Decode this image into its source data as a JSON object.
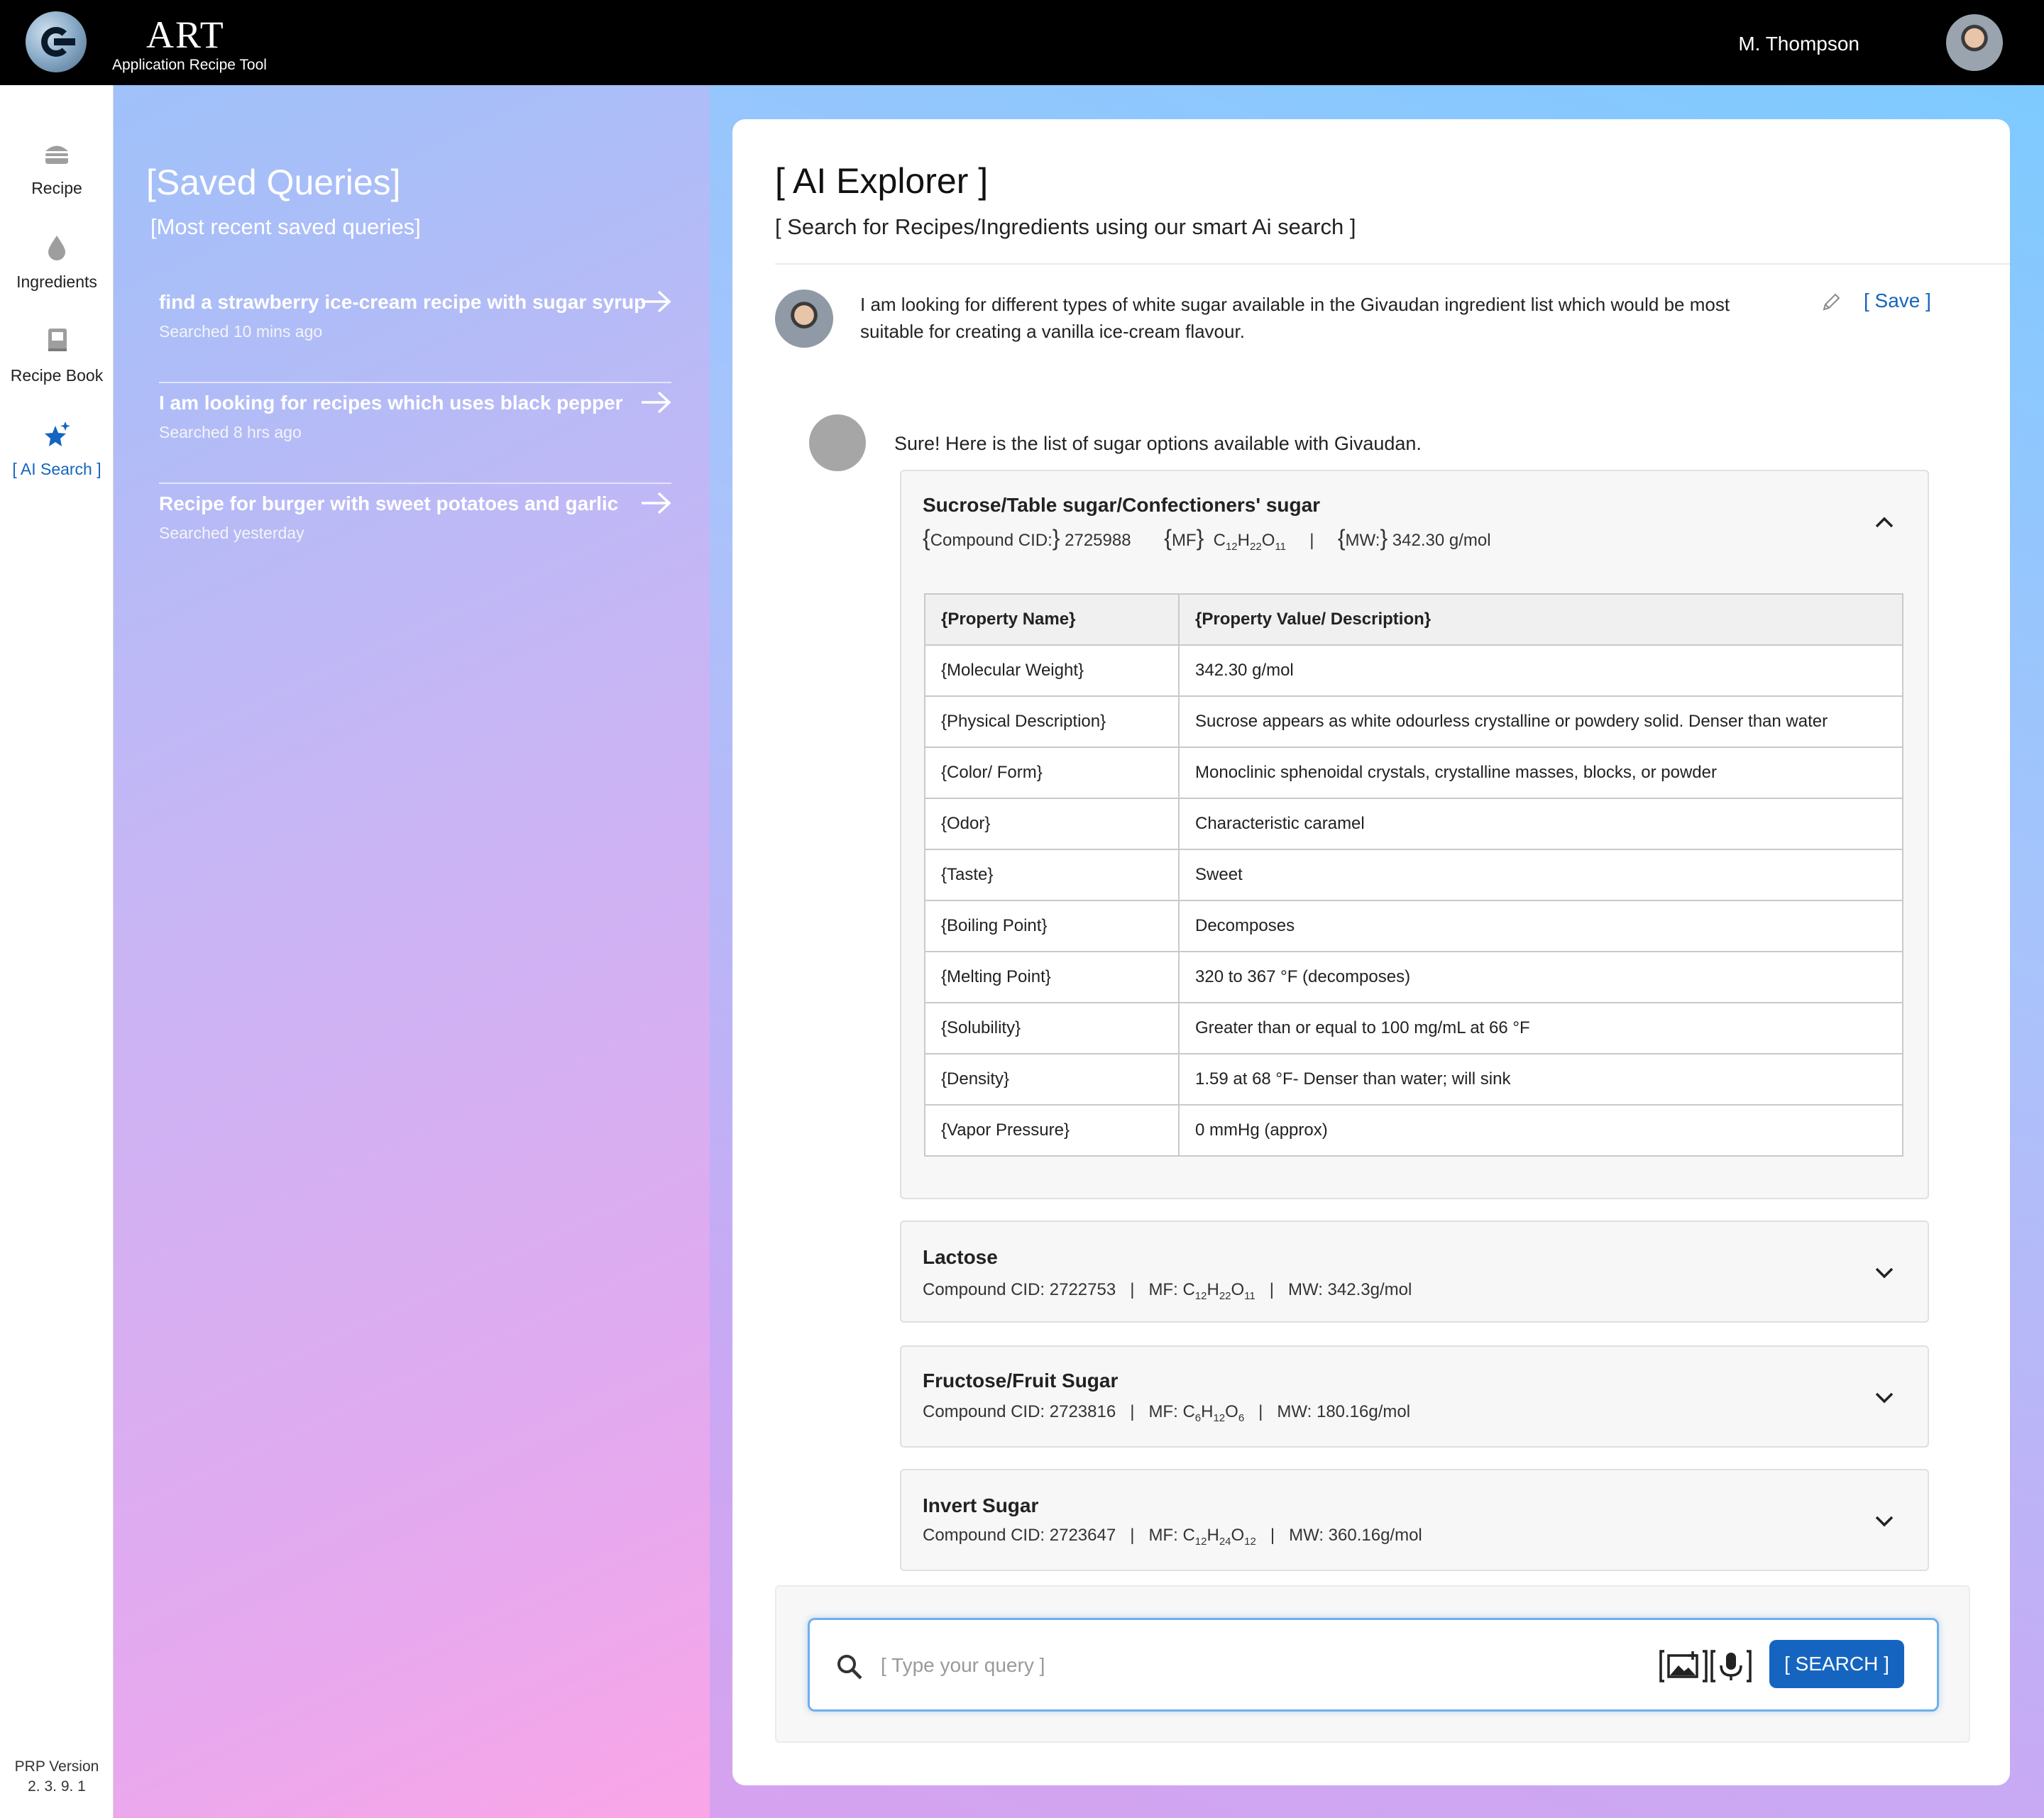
{
  "header": {
    "app_name": "ART",
    "app_subtitle": "Application Recipe Tool",
    "user_name": "M. Thompson"
  },
  "nav": {
    "items": [
      {
        "label": "Recipe",
        "icon": "burger-icon"
      },
      {
        "label": "Ingredients",
        "icon": "drop-icon"
      },
      {
        "label": "Recipe Book",
        "icon": "book-icon"
      },
      {
        "label": "[ AI Search ]",
        "icon": "sparkle-star-icon",
        "active": true
      }
    ],
    "version_label": "PRP Version",
    "version_number": "2. 3. 9. 1"
  },
  "saved_queries": {
    "title": "[Saved Queries]",
    "subtitle": "[Most recent saved queries]",
    "items": [
      {
        "query": "find a strawberry ice-cream recipe with sugar syrup",
        "time": "Searched 10 mins ago"
      },
      {
        "query": "I am looking for recipes which uses black pepper",
        "time": "Searched 8 hrs ago"
      },
      {
        "query": "Recipe for burger with sweet potatoes and garlic",
        "time": "Searched yesterday"
      }
    ]
  },
  "explorer": {
    "title": "[ AI Explorer ]",
    "subtitle": "[ Search for Recipes/Ingredients using our smart Ai search ]",
    "user_message": "I am looking for different types of white sugar available in the Givaudan ingredient list which would be most suitable  for creating a vanilla ice-cream flavour.",
    "save_label": "[ Save ]",
    "bot_message": "Sure! Here is the list of sugar options available with Givaudan.",
    "results": [
      {
        "name": "Sucrose/Table sugar/Confectioners' sugar",
        "cid_label": "Compound CID:",
        "cid": "2725988",
        "mf_label": "MF",
        "mf": [
          "C",
          "12",
          "H",
          "22",
          "O",
          "11"
        ],
        "mw_label": "MW:",
        "mw": "342.30 g/mol",
        "expanded": true,
        "table_headers": [
          "Property Name",
          "Property Value/ Description"
        ],
        "properties": [
          {
            "name": "Molecular Weight",
            "value": "342.30 g/mol"
          },
          {
            "name": "Physical Description",
            "value": "Sucrose appears as white odourless crystalline or powdery solid. Denser than water"
          },
          {
            "name": "Color/ Form",
            "value": "Monoclinic sphenoidal crystals, crystalline masses, blocks, or powder"
          },
          {
            "name": "Odor",
            "value": "Characteristic caramel"
          },
          {
            "name": "Taste",
            "value": "Sweet"
          },
          {
            "name": "Boiling Point",
            "value": "Decomposes"
          },
          {
            "name": "Melting Point",
            "value": "320 to 367 °F (decomposes)"
          },
          {
            "name": "Solubility",
            "value": "Greater than or equal to 100 mg/mL at 66 °F"
          },
          {
            "name": "Density",
            "value": "1.59 at 68 °F- Denser than water; will sink"
          },
          {
            "name": "Vapor Pressure",
            "value": "0 mmHg (approx)"
          }
        ]
      },
      {
        "name": "Lactose",
        "cid_text": "Compound CID: 2722753",
        "mf_prefix": "MF: ",
        "mf": [
          "C",
          "12",
          "H",
          "22",
          "O",
          "11"
        ],
        "mw_text": "MW: 342.3g/mol",
        "expanded": false
      },
      {
        "name": "Fructose/Fruit Sugar",
        "cid_text": "Compound CID: 2723816",
        "mf_prefix": "MF: ",
        "mf": [
          "C",
          "6",
          "H",
          "12",
          "O",
          "6"
        ],
        "mw_text": "MW: 180.16g/mol",
        "expanded": false
      },
      {
        "name": "Invert Sugar",
        "cid_text": "Compound CID: 2723647",
        "mf_prefix": "MF: ",
        "mf": [
          "C",
          "12",
          "H",
          "24",
          "O",
          "12"
        ],
        "mw_text": "MW: 360.16g/mol",
        "expanded": false
      }
    ]
  },
  "search": {
    "placeholder": "[ Type your query ]",
    "button_label": "[ SEARCH ]"
  },
  "colors": {
    "accent": "#1565c0",
    "topbar": "#000000"
  }
}
